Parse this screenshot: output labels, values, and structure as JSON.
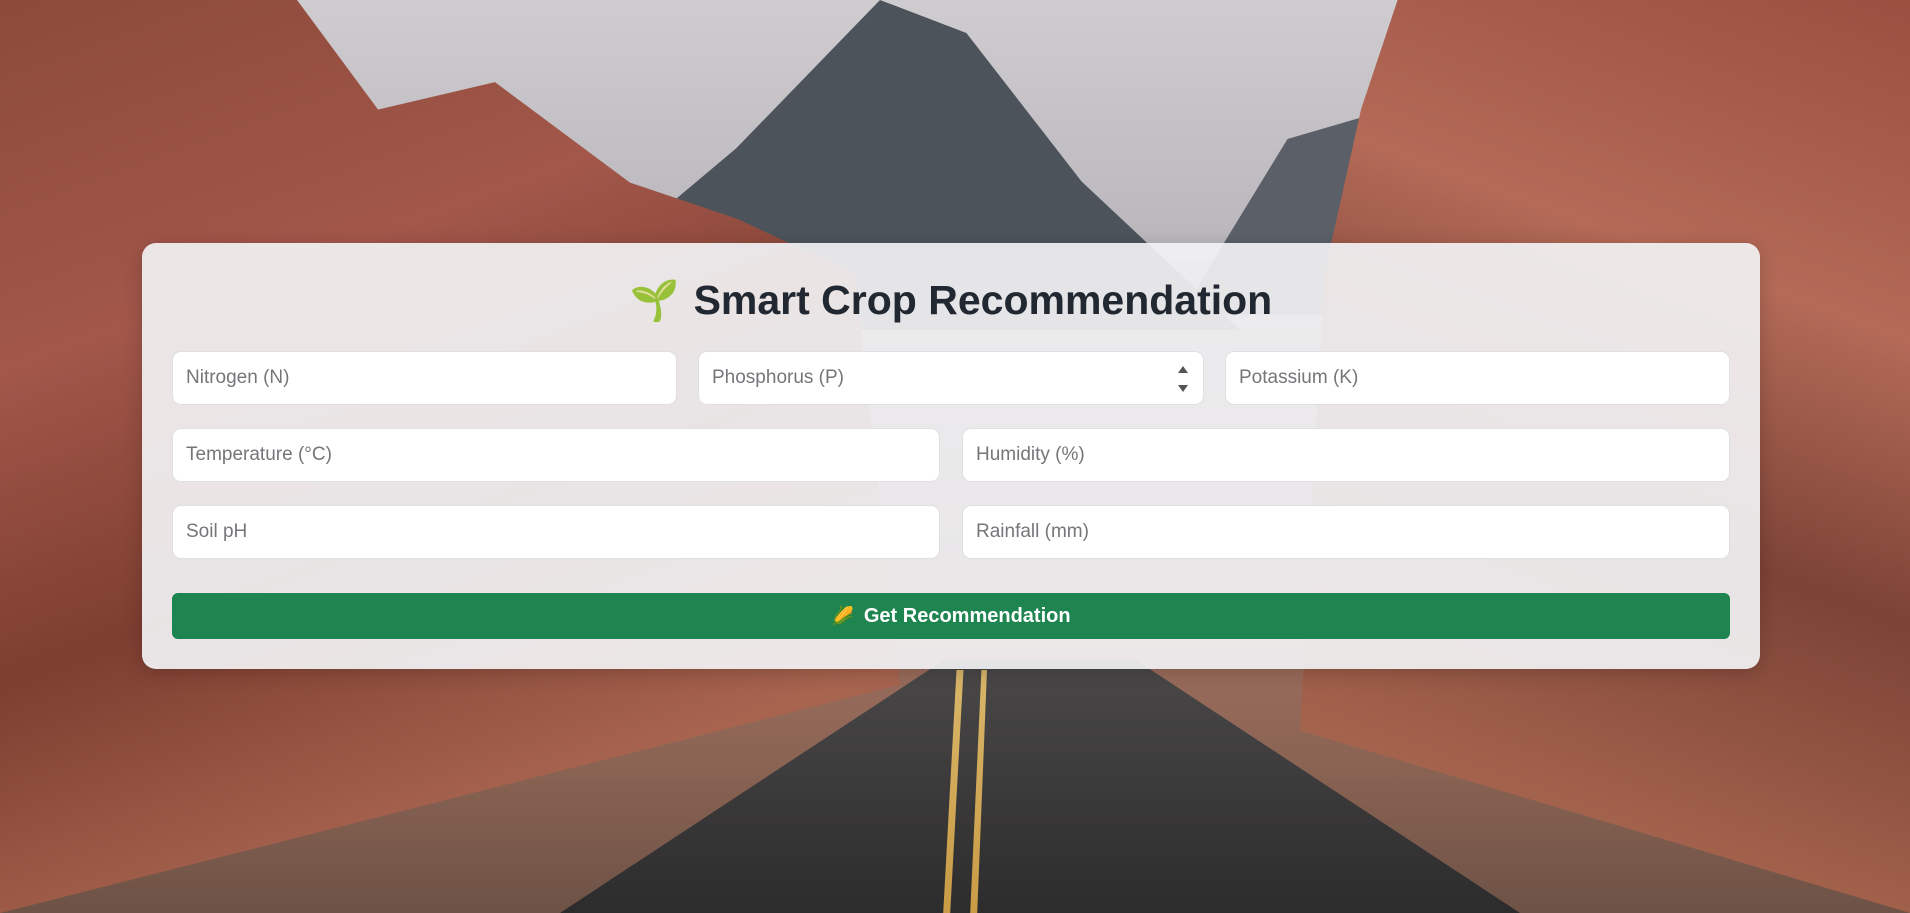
{
  "app": {
    "title": "Smart Crop Recommendation",
    "title_icon": "seedling-icon",
    "title_icon_glyph": "🌱"
  },
  "form": {
    "fields": {
      "nitrogen": {
        "placeholder": "Nitrogen (N)",
        "value": ""
      },
      "phosphorus": {
        "placeholder": "Phosphorus (P)",
        "value": ""
      },
      "potassium": {
        "placeholder": "Potassium (K)",
        "value": ""
      },
      "temperature": {
        "placeholder": "Temperature (°C)",
        "value": ""
      },
      "humidity": {
        "placeholder": "Humidity (%)",
        "value": ""
      },
      "ph": {
        "placeholder": "Soil pH",
        "value": ""
      },
      "rainfall": {
        "placeholder": "Rainfall (mm)",
        "value": ""
      }
    },
    "submit": {
      "label": "Get Recommendation",
      "icon": "corn-icon",
      "icon_glyph": "🌽"
    }
  },
  "colors": {
    "button": "#1e8450",
    "title_text": "#222831",
    "card_bg": "#f2f2f4"
  }
}
